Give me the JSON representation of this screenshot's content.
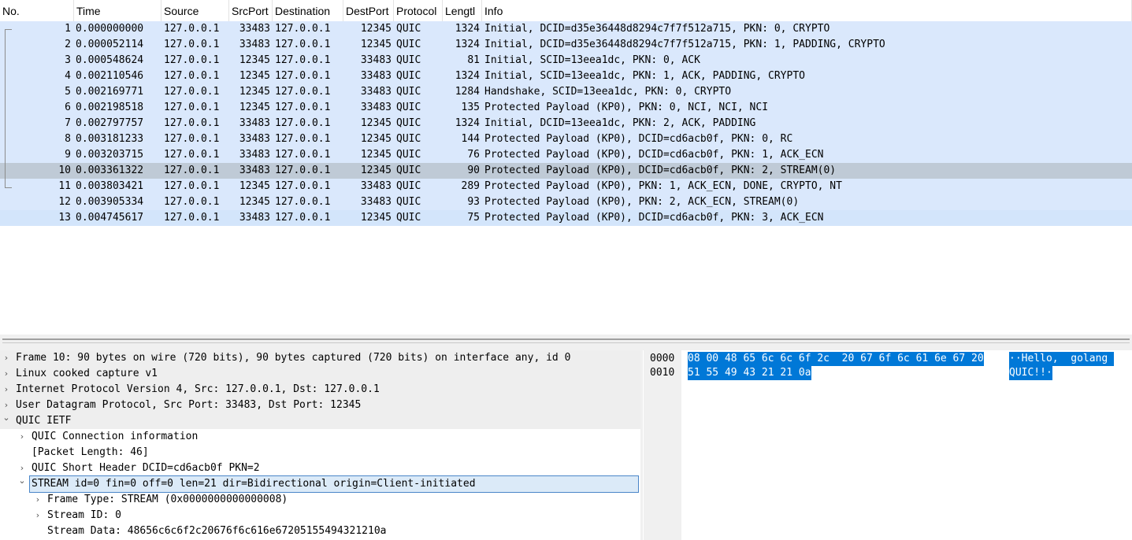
{
  "packet_list": {
    "columns": [
      "No.",
      "Time",
      "Source",
      "SrcPort",
      "Destination",
      "DestPort",
      "Protocol",
      "Lengtl",
      "Info"
    ],
    "rows": [
      {
        "no": "1",
        "time": "0.000000000",
        "src": "127.0.0.1",
        "srcport": "33483",
        "dst": "127.0.0.1",
        "dstport": "12345",
        "proto": "QUIC",
        "len": "1324",
        "info": "Initial, DCID=d35e36448d8294c7f7f512a715, PKN: 0, CRYPTO"
      },
      {
        "no": "2",
        "time": "0.000052114",
        "src": "127.0.0.1",
        "srcport": "33483",
        "dst": "127.0.0.1",
        "dstport": "12345",
        "proto": "QUIC",
        "len": "1324",
        "info": "Initial, DCID=d35e36448d8294c7f7f512a715, PKN: 1, PADDING, CRYPTO"
      },
      {
        "no": "3",
        "time": "0.000548624",
        "src": "127.0.0.1",
        "srcport": "12345",
        "dst": "127.0.0.1",
        "dstport": "33483",
        "proto": "QUIC",
        "len": "81",
        "info": "Initial, SCID=13eea1dc, PKN: 0, ACK"
      },
      {
        "no": "4",
        "time": "0.002110546",
        "src": "127.0.0.1",
        "srcport": "12345",
        "dst": "127.0.0.1",
        "dstport": "33483",
        "proto": "QUIC",
        "len": "1324",
        "info": "Initial, SCID=13eea1dc, PKN: 1, ACK, PADDING, CRYPTO"
      },
      {
        "no": "5",
        "time": "0.002169771",
        "src": "127.0.0.1",
        "srcport": "12345",
        "dst": "127.0.0.1",
        "dstport": "33483",
        "proto": "QUIC",
        "len": "1284",
        "info": "Handshake, SCID=13eea1dc, PKN: 0, CRYPTO"
      },
      {
        "no": "6",
        "time": "0.002198518",
        "src": "127.0.0.1",
        "srcport": "12345",
        "dst": "127.0.0.1",
        "dstport": "33483",
        "proto": "QUIC",
        "len": "135",
        "info": "Protected Payload (KP0), PKN: 0, NCI, NCI, NCI"
      },
      {
        "no": "7",
        "time": "0.002797757",
        "src": "127.0.0.1",
        "srcport": "33483",
        "dst": "127.0.0.1",
        "dstport": "12345",
        "proto": "QUIC",
        "len": "1324",
        "info": "Initial, DCID=13eea1dc, PKN: 2, ACK, PADDING"
      },
      {
        "no": "8",
        "time": "0.003181233",
        "src": "127.0.0.1",
        "srcport": "33483",
        "dst": "127.0.0.1",
        "dstport": "12345",
        "proto": "QUIC",
        "len": "144",
        "info": "Protected Payload (KP0), DCID=cd6acb0f, PKN: 0, RC"
      },
      {
        "no": "9",
        "time": "0.003203715",
        "src": "127.0.0.1",
        "srcport": "33483",
        "dst": "127.0.0.1",
        "dstport": "12345",
        "proto": "QUIC",
        "len": "76",
        "info": "Protected Payload (KP0), DCID=cd6acb0f, PKN: 1, ACK_ECN"
      },
      {
        "no": "10",
        "time": "0.003361322",
        "src": "127.0.0.1",
        "srcport": "33483",
        "dst": "127.0.0.1",
        "dstport": "12345",
        "proto": "QUIC",
        "len": "90",
        "info": "Protected Payload (KP0), DCID=cd6acb0f, PKN: 2, STREAM(0)",
        "selected": true
      },
      {
        "no": "11",
        "time": "0.003803421",
        "src": "127.0.0.1",
        "srcport": "12345",
        "dst": "127.0.0.1",
        "dstport": "33483",
        "proto": "QUIC",
        "len": "289",
        "info": "Protected Payload (KP0), PKN: 1, ACK_ECN, DONE, CRYPTO, NT"
      },
      {
        "no": "12",
        "time": "0.003905334",
        "src": "127.0.0.1",
        "srcport": "12345",
        "dst": "127.0.0.1",
        "dstport": "33483",
        "proto": "QUIC",
        "len": "93",
        "info": "Protected Payload (KP0), PKN: 2, ACK_ECN, STREAM(0)"
      },
      {
        "no": "13",
        "time": "0.004745617",
        "src": "127.0.0.1",
        "srcport": "33483",
        "dst": "127.0.0.1",
        "dstport": "12345",
        "proto": "QUIC",
        "len": "75",
        "info": "Protected Payload (KP0), DCID=cd6acb0f, PKN: 3, ACK_ECN"
      }
    ]
  },
  "details": [
    {
      "text": "Frame 10: 90 bytes on wire (720 bits), 90 bytes captured (720 bits) on interface any, id 0",
      "arrow": "›",
      "level": 0
    },
    {
      "text": "Linux cooked capture v1",
      "arrow": "›",
      "level": 0
    },
    {
      "text": "Internet Protocol Version 4, Src: 127.0.0.1, Dst: 127.0.0.1",
      "arrow": "›",
      "level": 0
    },
    {
      "text": "User Datagram Protocol, Src Port: 33483, Dst Port: 12345",
      "arrow": "›",
      "level": 0
    },
    {
      "text": "QUIC IETF",
      "arrow": "⌄",
      "level": 0
    },
    {
      "text": "QUIC Connection information",
      "arrow": "›",
      "level": 1
    },
    {
      "text": "[Packet Length: 46]",
      "arrow": "",
      "level": 1
    },
    {
      "text": "QUIC Short Header DCID=cd6acb0f PKN=2",
      "arrow": "›",
      "level": 1
    },
    {
      "text": "STREAM id=0 fin=0 off=0 len=21 dir=Bidirectional origin=Client-initiated",
      "arrow": "⌄",
      "level": 1,
      "selected": true
    },
    {
      "text": "Frame Type: STREAM (0x0000000000000008)",
      "arrow": "›",
      "level": 2
    },
    {
      "text": "Stream ID: 0",
      "arrow": "›",
      "level": 2
    },
    {
      "text": "Stream Data: 48656c6c6f2c20676f6c616e67205155494321210a",
      "arrow": "",
      "level": 2
    }
  ],
  "hex": [
    {
      "offset": "0000",
      "bytes": "08 00 48 65 6c 6c 6f 2c  20 67 6f 6c 61 6e 67 20",
      "ascii": "··Hello,  golang "
    },
    {
      "offset": "0010",
      "bytes": "51 55 49 43 21 21 0a",
      "ascii": "QUIC!!·"
    }
  ],
  "colors": {
    "row_bg": "#dae8fc",
    "selected_row": "#bfcad6",
    "hex_highlight": "#0078d7"
  }
}
